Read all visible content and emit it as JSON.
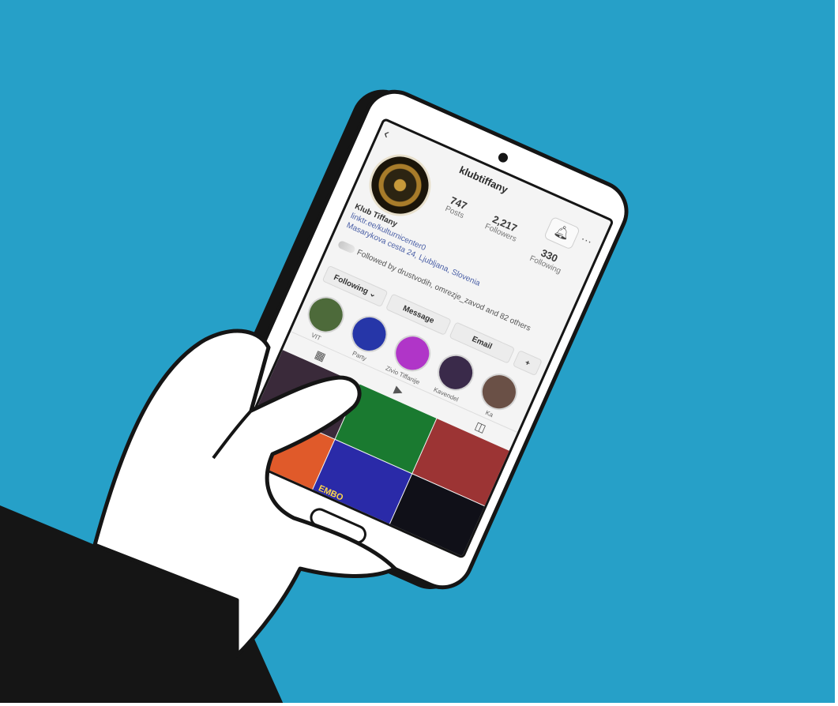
{
  "colors": {
    "background": "#26a0c8",
    "outline": "#151515",
    "hand": "#ffffff",
    "sleeve": "#151515"
  },
  "profile": {
    "username": "klubtiffany",
    "back_icon": "back-arrow-icon",
    "notify_icon": "bell-icon",
    "more_icon": "more-dots-icon",
    "stats": [
      {
        "value": "747",
        "label": "Posts"
      },
      {
        "value": "2,217",
        "label": "Followers"
      },
      {
        "value": "330",
        "label": "Following"
      }
    ],
    "name": "Klub Tiffany",
    "link": "linktr.ee/kulturnicenter0",
    "address": "Masarykova cesta 24, Ljubljana, Slovenia",
    "followed_by": "Followed by drustvodih, omrezje_zavod and 82 others",
    "buttons": {
      "following": "Following ⌄",
      "message": "Message",
      "email": "Email"
    },
    "highlights": [
      {
        "label": "VIT",
        "color": "#4d6a3a"
      },
      {
        "label": "Party",
        "color": "#2636a8"
      },
      {
        "label": "Zivio Tiffanije",
        "color": "#b035c8"
      },
      {
        "label": "Kavendel",
        "color": "#3a2a4a"
      },
      {
        "label": "Ka",
        "color": "#6a5046"
      }
    ],
    "tabs": [
      "grid-icon",
      "reels-icon",
      "tagged-icon"
    ],
    "tiles": [
      {
        "color": "#3a2a3a",
        "tag": ""
      },
      {
        "color": "#1a7a30",
        "tag": ""
      },
      {
        "color": "#9c3434",
        "tag": ""
      },
      {
        "color": "#e05a2a",
        "tag": ""
      },
      {
        "color": "#2a2aa8",
        "tag": "EMBO"
      },
      {
        "color": "#101018",
        "tag": ""
      }
    ]
  }
}
